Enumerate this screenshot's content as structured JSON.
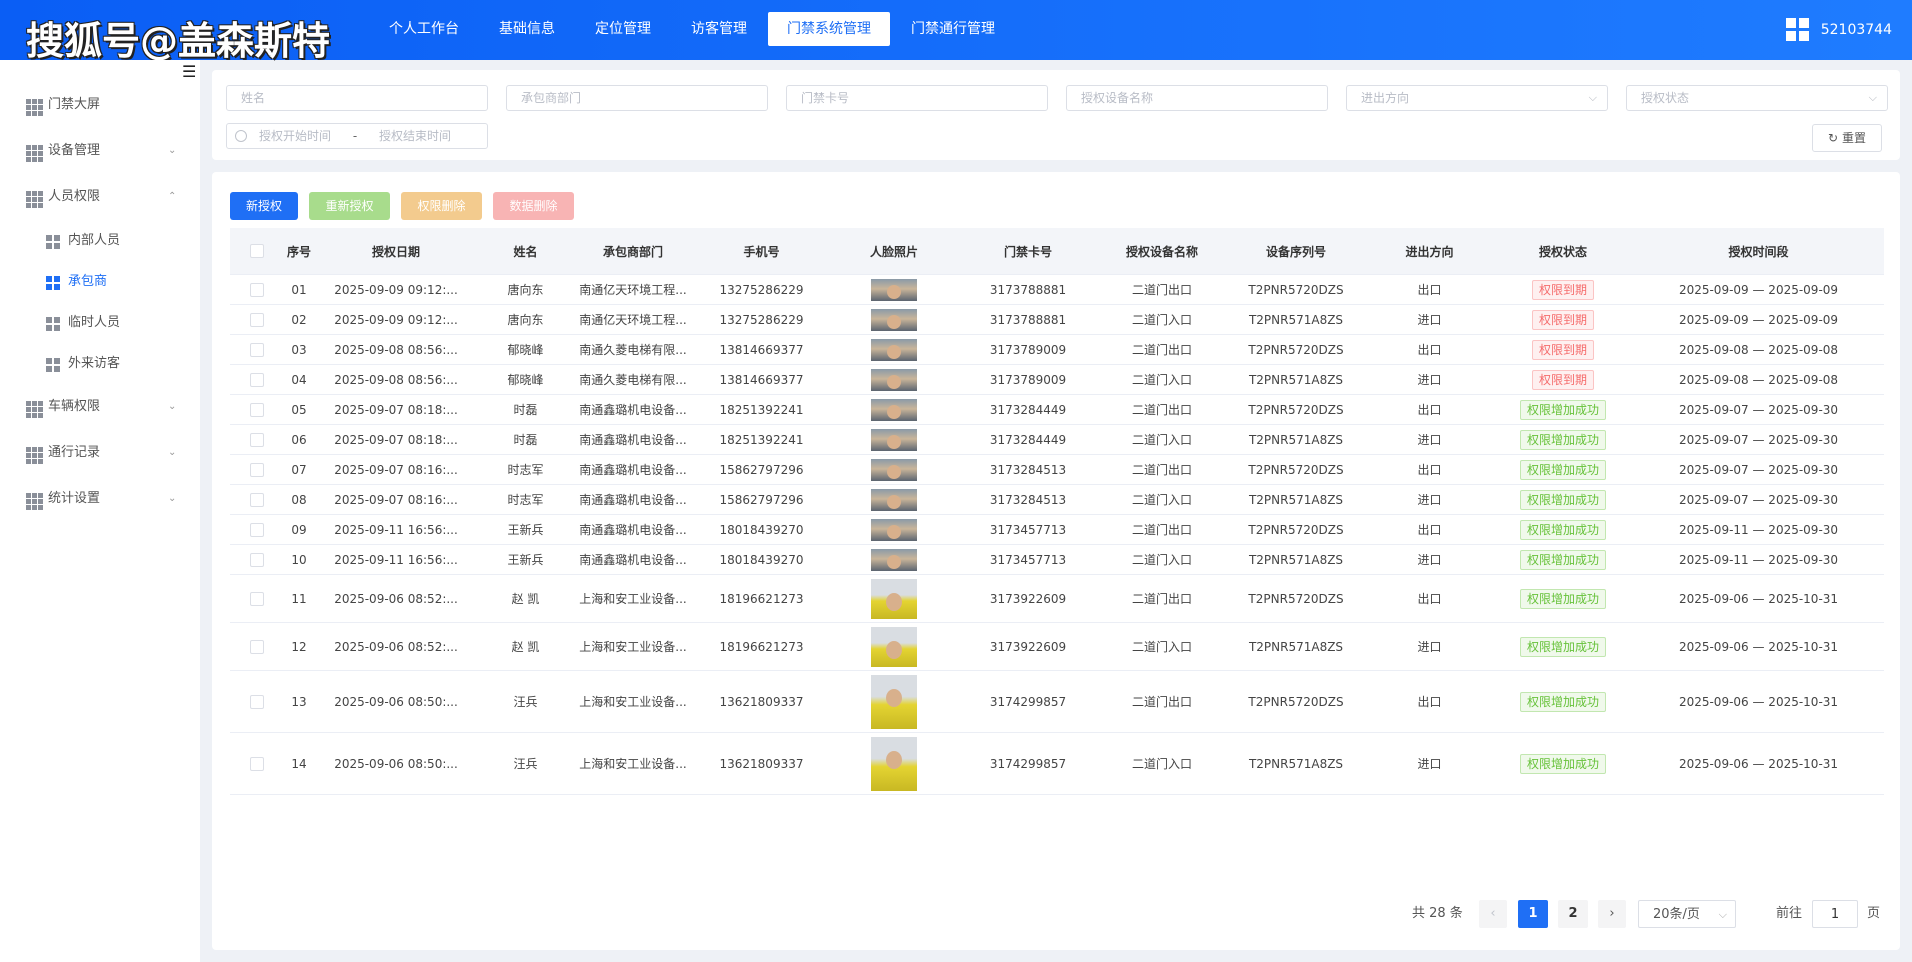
{
  "header": {
    "watermark": "搜狐号@盖森斯特",
    "nav": [
      "个人工作台",
      "基础信息",
      "定位管理",
      "访客管理",
      "门禁系统管理",
      "门禁通行管理"
    ],
    "active_nav": "门禁系统管理",
    "user_id": "52103744"
  },
  "sidebar": {
    "items": [
      {
        "label": "门禁大屏",
        "has_chevron": false
      },
      {
        "label": "设备管理",
        "has_chevron": true,
        "chevron": "⌄"
      },
      {
        "label": "人员权限",
        "has_chevron": true,
        "chevron": "⌃"
      },
      {
        "label": "内部人员",
        "sub": true
      },
      {
        "label": "承包商",
        "sub": true,
        "active": true
      },
      {
        "label": "临时人员",
        "sub": true
      },
      {
        "label": "外来访客",
        "sub": true
      },
      {
        "label": "车辆权限",
        "has_chevron": true,
        "chevron": "⌄"
      },
      {
        "label": "通行记录",
        "has_chevron": true,
        "chevron": "⌄"
      },
      {
        "label": "统计设置",
        "has_chevron": true,
        "chevron": "⌄"
      }
    ]
  },
  "filters": {
    "name_placeholder": "姓名",
    "dept_placeholder": "承包商部门",
    "card_placeholder": "门禁卡号",
    "device_placeholder": "授权设备名称",
    "direction_placeholder": "进出方向",
    "status_placeholder": "授权状态",
    "start_placeholder": "授权开始时间",
    "range_sep": "-",
    "end_placeholder": "授权结束时间",
    "reset_label": "重置"
  },
  "toolbar": {
    "new_label": "新授权",
    "reauth_label": "重新授权",
    "delete_perm_label": "权限删除",
    "delete_data_label": "数据删除"
  },
  "colors": {
    "primary": "#1f6ff5",
    "reauth": "#a8dc8c",
    "delete_perm": "#f3cb8e",
    "delete_data": "#f8b4b4"
  },
  "table": {
    "columns": [
      "序号",
      "授权日期",
      "姓名",
      "承包商部门",
      "手机号",
      "人脸照片",
      "门禁卡号",
      "授权设备名称",
      "设备序列号",
      "进出方向",
      "授权状态",
      "授权时间段"
    ],
    "rows": [
      [
        "01",
        "2025-09-09 09:12:...",
        "唐向东",
        "南通亿天环境工程...",
        "13275286229",
        "",
        "3173788881",
        "二道门出口",
        "T2PNR5720DZS",
        "出口",
        "权限到期",
        "2025-09-09 — 2025-09-09"
      ],
      [
        "02",
        "2025-09-09 09:12:...",
        "唐向东",
        "南通亿天环境工程...",
        "13275286229",
        "",
        "3173788881",
        "二道门入口",
        "T2PNR571A8ZS",
        "进口",
        "权限到期",
        "2025-09-09 — 2025-09-09"
      ],
      [
        "03",
        "2025-09-08 08:56:...",
        "郁晓峰",
        "南通久菱电梯有限...",
        "13814669377",
        "",
        "3173789009",
        "二道门出口",
        "T2PNR5720DZS",
        "出口",
        "权限到期",
        "2025-09-08 — 2025-09-08"
      ],
      [
        "04",
        "2025-09-08 08:56:...",
        "郁晓峰",
        "南通久菱电梯有限...",
        "13814669377",
        "",
        "3173789009",
        "二道门入口",
        "T2PNR571A8ZS",
        "进口",
        "权限到期",
        "2025-09-08 — 2025-09-08"
      ],
      [
        "05",
        "2025-09-07 08:18:...",
        "时磊",
        "南通鑫璐机电设备...",
        "18251392241",
        "",
        "3173284449",
        "二道门出口",
        "T2PNR5720DZS",
        "出口",
        "权限增加成功",
        "2025-09-07 — 2025-09-30"
      ],
      [
        "06",
        "2025-09-07 08:18:...",
        "时磊",
        "南通鑫璐机电设备...",
        "18251392241",
        "",
        "3173284449",
        "二道门入口",
        "T2PNR571A8ZS",
        "进口",
        "权限增加成功",
        "2025-09-07 — 2025-09-30"
      ],
      [
        "07",
        "2025-09-07 08:16:...",
        "时志军",
        "南通鑫璐机电设备...",
        "15862797296",
        "",
        "3173284513",
        "二道门出口",
        "T2PNR5720DZS",
        "出口",
        "权限增加成功",
        "2025-09-07 — 2025-09-30"
      ],
      [
        "08",
        "2025-09-07 08:16:...",
        "时志军",
        "南通鑫璐机电设备...",
        "15862797296",
        "",
        "3173284513",
        "二道门入口",
        "T2PNR571A8ZS",
        "进口",
        "权限增加成功",
        "2025-09-07 — 2025-09-30"
      ],
      [
        "09",
        "2025-09-11 16:56:...",
        "王新兵",
        "南通鑫璐机电设备...",
        "18018439270",
        "",
        "3173457713",
        "二道门出口",
        "T2PNR5720DZS",
        "出口",
        "权限增加成功",
        "2025-09-11 — 2025-09-30"
      ],
      [
        "10",
        "2025-09-11 16:56:...",
        "王新兵",
        "南通鑫璐机电设备...",
        "18018439270",
        "",
        "3173457713",
        "二道门入口",
        "T2PNR571A8ZS",
        "进口",
        "权限增加成功",
        "2025-09-11 — 2025-09-30"
      ],
      [
        "11",
        "2025-09-06 08:52:...",
        "赵 凯",
        "上海和安工业设备...",
        "18196621273",
        "",
        "3173922609",
        "二道门出口",
        "T2PNR5720DZS",
        "出口",
        "权限增加成功",
        "2025-09-06 — 2025-10-31"
      ],
      [
        "12",
        "2025-09-06 08:52:...",
        "赵 凯",
        "上海和安工业设备...",
        "18196621273",
        "",
        "3173922609",
        "二道门入口",
        "T2PNR571A8ZS",
        "进口",
        "权限增加成功",
        "2025-09-06 — 2025-10-31"
      ],
      [
        "13",
        "2025-09-06 08:50:...",
        "汪兵",
        "上海和安工业设备...",
        "13621809337",
        "",
        "3174299857",
        "二道门出口",
        "T2PNR5720DZS",
        "出口",
        "权限增加成功",
        "2025-09-06 — 2025-10-31"
      ],
      [
        "14",
        "2025-09-06 08:50:...",
        "汪兵",
        "上海和安工业设备...",
        "13621809337",
        "",
        "3174299857",
        "二道门入口",
        "T2PNR571A8ZS",
        "进口",
        "权限增加成功",
        "2025-09-06 — 2025-10-31"
      ]
    ]
  },
  "pagination": {
    "total": "共 28 条",
    "pages": [
      "1",
      "2"
    ],
    "current": "1",
    "page_size": "20条/页",
    "goto_prefix": "前往",
    "goto_value": "1",
    "goto_suffix": "页",
    "prev": "‹",
    "next": "›"
  }
}
